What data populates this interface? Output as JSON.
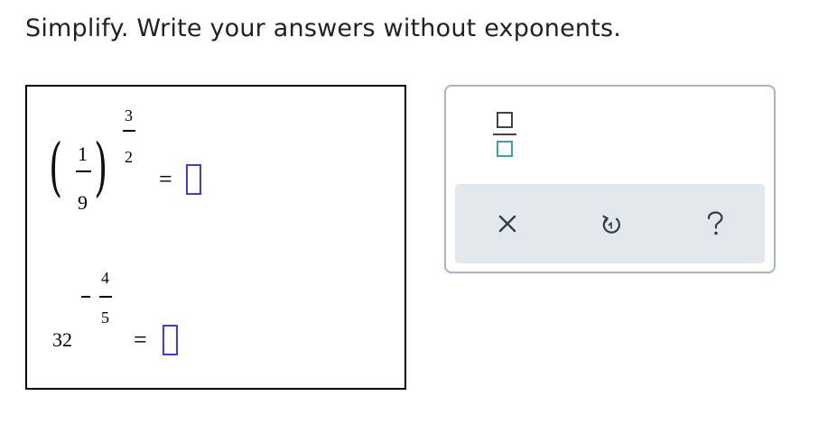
{
  "instruction": "Simplify. Write your answers without exponents.",
  "problem1": {
    "base_numerator": "1",
    "base_denominator": "9",
    "exponent_numerator": "3",
    "exponent_denominator": "2",
    "equals": "=",
    "answer": ""
  },
  "problem2": {
    "base": "32",
    "exponent_sign": "−",
    "exponent_numerator": "4",
    "exponent_denominator": "5",
    "equals": "=",
    "answer": ""
  },
  "tools": {
    "fraction_icon": "fraction-template-icon",
    "clear_icon": "close-icon",
    "undo_icon": "undo-icon",
    "help_icon": "question-mark-icon"
  },
  "colors": {
    "answer_border": "#3a3aff",
    "panel_border": "#a9b7c4",
    "action_bar_bg": "#e3e8ed",
    "fraction_accent": "#3aa0b6",
    "icon_color": "#2f3d4a"
  }
}
